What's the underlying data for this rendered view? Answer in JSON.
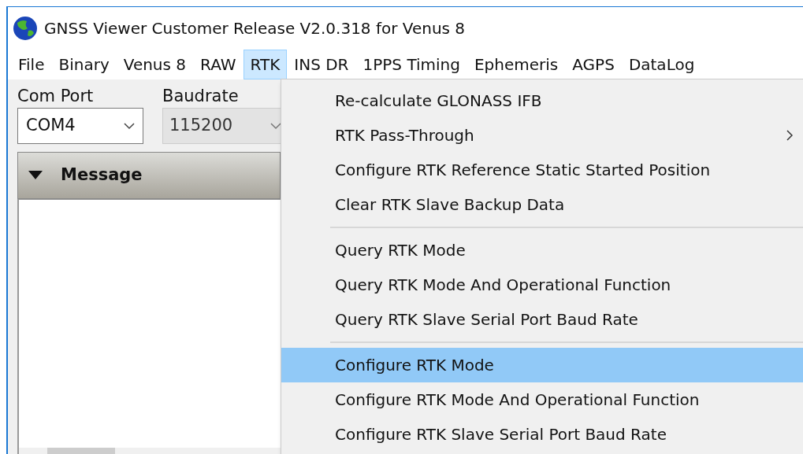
{
  "window": {
    "title": "GNSS Viewer Customer Release V2.0.318 for Venus 8"
  },
  "menu_bar": [
    {
      "label": "File",
      "selected": false
    },
    {
      "label": "Binary",
      "selected": false
    },
    {
      "label": "Venus 8",
      "selected": false
    },
    {
      "label": "RAW",
      "selected": false
    },
    {
      "label": "RTK",
      "selected": true
    },
    {
      "label": "INS DR",
      "selected": false
    },
    {
      "label": "1PPS Timing",
      "selected": false
    },
    {
      "label": "Ephemeris",
      "selected": false
    },
    {
      "label": "AGPS",
      "selected": false
    },
    {
      "label": "DataLog",
      "selected": false
    }
  ],
  "com_port": {
    "label": "Com Port",
    "value": "COM4"
  },
  "baudrate": {
    "label": "Baudrate",
    "value": "115200",
    "disabled": true
  },
  "message_panel": {
    "title": "Message",
    "expanded": true
  },
  "dropdown": [
    {
      "kind": "item",
      "label": "Re-calculate GLONASS IFB",
      "submenu": false,
      "selected": false
    },
    {
      "kind": "item",
      "label": "RTK Pass-Through",
      "submenu": true,
      "selected": false
    },
    {
      "kind": "item",
      "label": "Configure RTK Reference Static Started Position",
      "submenu": false,
      "selected": false
    },
    {
      "kind": "item",
      "label": "Clear RTK Slave Backup Data",
      "submenu": false,
      "selected": false
    },
    {
      "kind": "separator"
    },
    {
      "kind": "item",
      "label": "Query RTK Mode",
      "submenu": false,
      "selected": false
    },
    {
      "kind": "item",
      "label": "Query RTK Mode And Operational Function",
      "submenu": false,
      "selected": false
    },
    {
      "kind": "item",
      "label": "Query RTK Slave Serial Port Baud Rate",
      "submenu": false,
      "selected": false
    },
    {
      "kind": "separator"
    },
    {
      "kind": "item",
      "label": "Configure RTK Mode",
      "submenu": false,
      "selected": true
    },
    {
      "kind": "item",
      "label": "Configure RTK Mode And Operational Function",
      "submenu": false,
      "selected": false
    },
    {
      "kind": "item",
      "label": "Configure RTK Slave Serial Port Baud Rate",
      "submenu": false,
      "selected": false
    }
  ]
}
